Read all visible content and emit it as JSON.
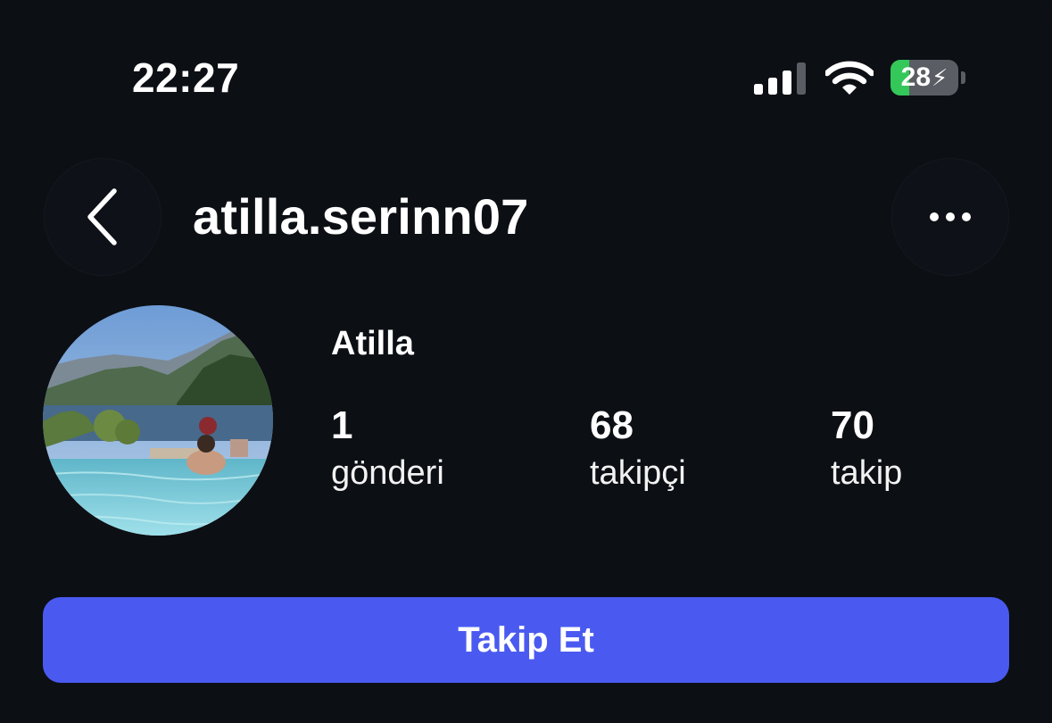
{
  "status_bar": {
    "time": "22:27",
    "battery_level": 28,
    "battery_label": "28",
    "signal_bars_active": 3,
    "signal_bars_total": 4,
    "charging": true,
    "battery_color": "#34c759"
  },
  "header": {
    "username": "atilla.serinn07",
    "back_icon": "chevron-left-icon",
    "more_icon": "ellipsis-horizontal-icon"
  },
  "profile": {
    "display_name": "Atilla",
    "stats": {
      "posts": {
        "value": "1",
        "label": "gönderi"
      },
      "followers": {
        "value": "68",
        "label": "takipçi"
      },
      "following": {
        "value": "70",
        "label": "takip"
      }
    }
  },
  "actions": {
    "follow_label": "Takip Et",
    "follow_color": "#4a5af0"
  },
  "colors": {
    "background": "#0c0f14",
    "text": "#ffffff"
  }
}
